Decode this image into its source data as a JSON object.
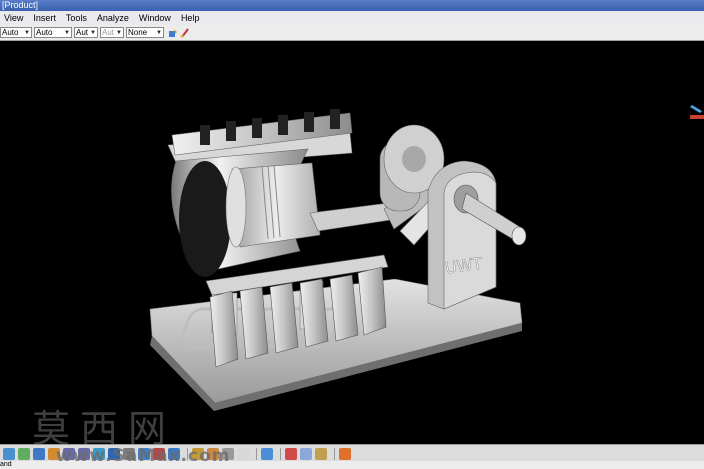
{
  "window": {
    "title": "[Product]"
  },
  "menu": {
    "items": [
      "View",
      "Insert",
      "Tools",
      "Analyze",
      "Window",
      "Help"
    ]
  },
  "toolbar": {
    "combos": [
      {
        "value": "Auto",
        "disabled": false
      },
      {
        "value": "Auto",
        "disabled": false
      },
      {
        "value": "Aut",
        "disabled": false
      },
      {
        "value": "Aut",
        "disabled": true
      },
      {
        "value": "None",
        "disabled": false
      }
    ],
    "icons": [
      "paint-icon",
      "brush-icon"
    ]
  },
  "viewport": {
    "model": "piston engine assembly",
    "engraving": "UWT",
    "background": "#000000"
  },
  "watermark": {
    "chinese": "莫西网",
    "url": "www.SaMax.com"
  },
  "statusbar": {
    "text": "and"
  },
  "colors": {
    "titlebar": "#3a5fae",
    "menubar": "#e9e9ee",
    "viewport": "#000000",
    "part": "#c8c8c8"
  }
}
